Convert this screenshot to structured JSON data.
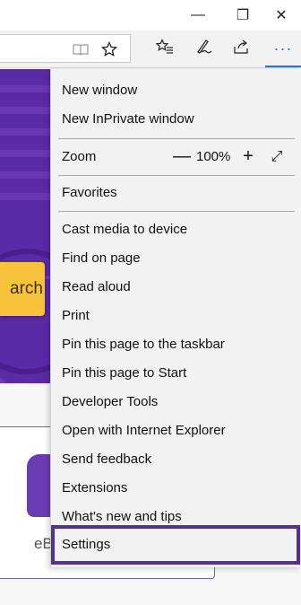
{
  "titlebar": {
    "minimize_glyph": "—",
    "restore_glyph": "❐",
    "close_glyph": "✕"
  },
  "toolbar": {
    "reading_view_icon": "reading-view-icon",
    "favorite_icon": "star-icon",
    "favorites_hub_icon": "favorites-hub-icon",
    "notes_icon": "pen-icon",
    "share_icon": "share-icon",
    "more_icon": "more-icon",
    "more_glyph": "···",
    "accent_color": "#2a73d9"
  },
  "page": {
    "search_button_label": "arch",
    "card_text": "eB",
    "hero_color": "#5b2aa6",
    "button_color": "#f6c33a"
  },
  "menu": {
    "new_window": "New window",
    "new_inprivate": "New InPrivate window",
    "zoom_label": "Zoom",
    "zoom_minus": "—",
    "zoom_value": "100%",
    "zoom_plus": "+",
    "zoom_fullscreen": "⤢",
    "favorites": "Favorites",
    "cast_media": "Cast media to device",
    "find_on_page": "Find on page",
    "read_aloud": "Read aloud",
    "print": "Print",
    "pin_taskbar": "Pin this page to the taskbar",
    "pin_start": "Pin this page to Start",
    "developer_tools": "Developer Tools",
    "open_ie": "Open with Internet Explorer",
    "send_feedback": "Send feedback",
    "extensions": "Extensions",
    "whats_new": "What's new and tips",
    "settings": "Settings",
    "highlight_color": "#54308f"
  }
}
